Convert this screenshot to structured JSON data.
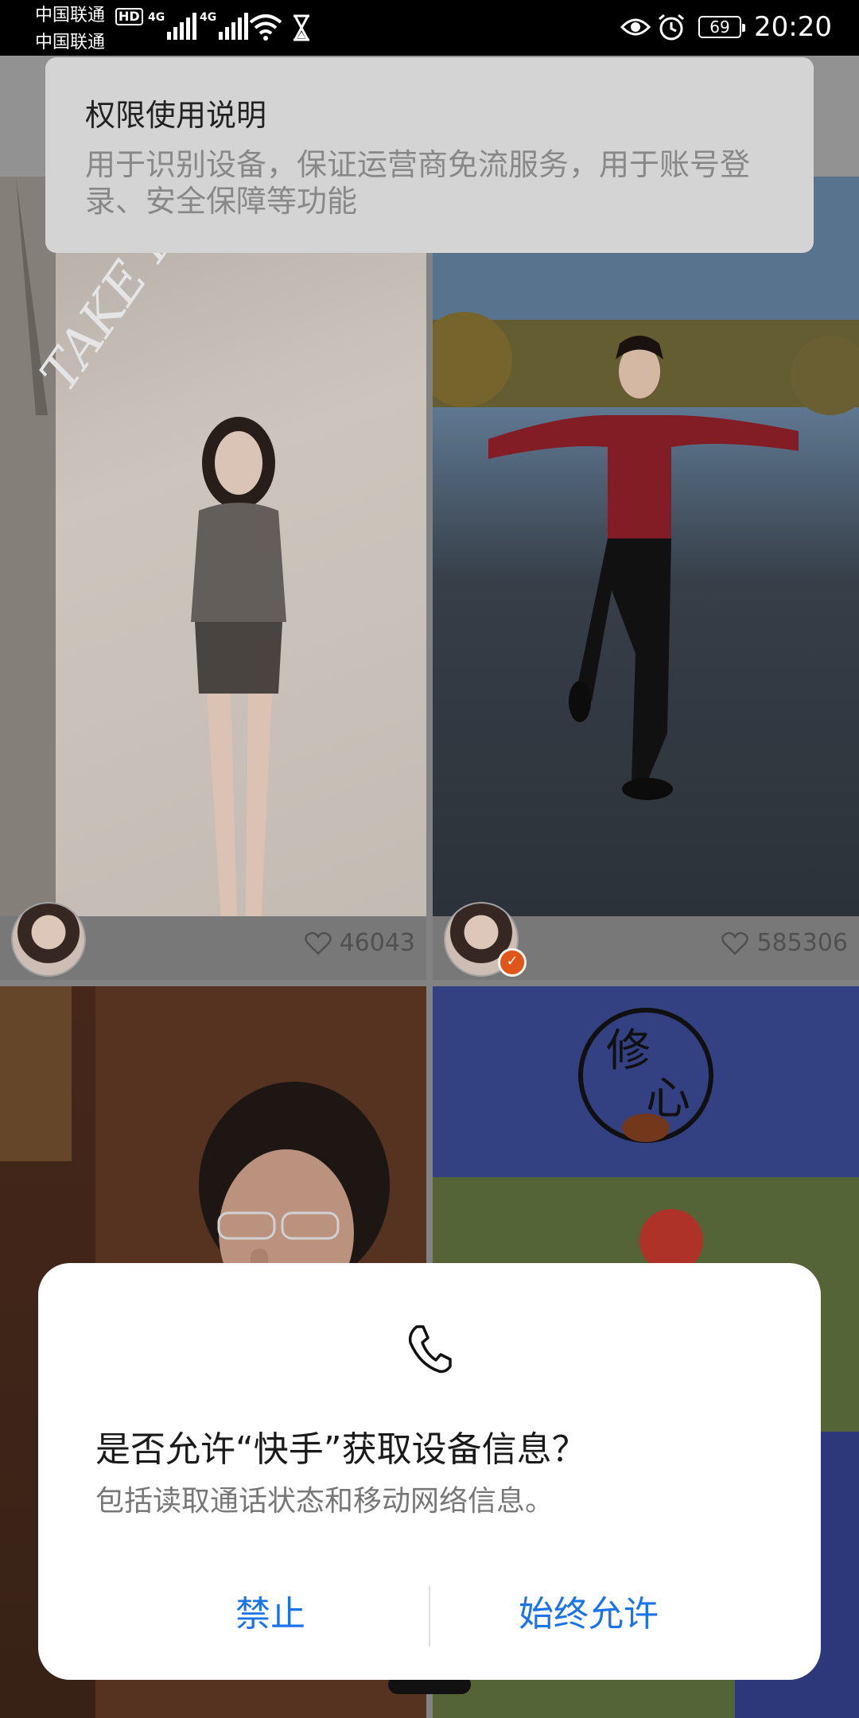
{
  "status_bar": {
    "carrier_1": "中国联通",
    "carrier_2": "中国联通",
    "hd_badge": "HD",
    "signal_1_label": "4G",
    "signal_2_label": "4G",
    "battery": "69",
    "time": "20:20",
    "icons": [
      "signal-icon",
      "wifi-icon",
      "hourglass-icon",
      "eye-icon",
      "alarm-icon",
      "battery-icon"
    ]
  },
  "banner": {
    "title": "权限使用说明",
    "text": "用于识别设备，保证运营商免流服务，用于账号登录、安全保障等功能"
  },
  "feed": {
    "cards": [
      {
        "likes": "46043",
        "verified": false
      },
      {
        "likes": "585306",
        "verified": true
      },
      {
        "likes": "",
        "verified": false
      },
      {
        "likes": "",
        "verified": false
      }
    ],
    "thumb_text": [
      "TAKE IT EA",
      "修心"
    ]
  },
  "dialog": {
    "icon": "phone-icon",
    "title": "是否允许“快手”获取设备信息？",
    "description": "包括读取通话状态和移动网络信息。",
    "deny_label": "禁止",
    "allow_label": "始终允许",
    "accent_color": "#1a73e8"
  }
}
